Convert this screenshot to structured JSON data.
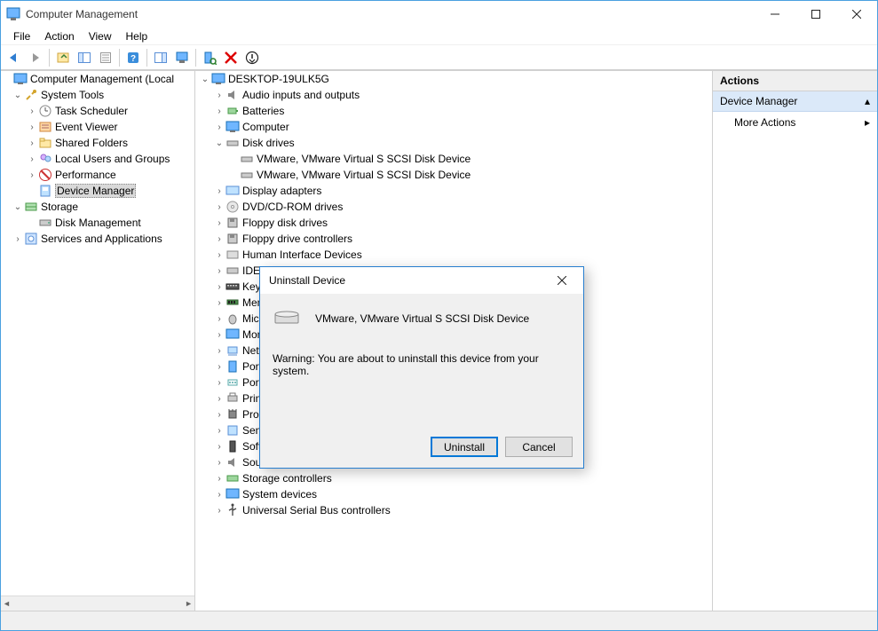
{
  "window": {
    "title": "Computer Management"
  },
  "menu": {
    "file": "File",
    "action": "Action",
    "view": "View",
    "help": "Help"
  },
  "left_tree": {
    "root": "Computer Management (Local",
    "system_tools": "System Tools",
    "task_scheduler": "Task Scheduler",
    "event_viewer": "Event Viewer",
    "shared_folders": "Shared Folders",
    "local_users": "Local Users and Groups",
    "performance": "Performance",
    "device_manager": "Device Manager",
    "storage": "Storage",
    "disk_management": "Disk Management",
    "services_apps": "Services and Applications"
  },
  "center_tree": {
    "root": "DESKTOP-19ULK5G",
    "audio": "Audio inputs and outputs",
    "batteries": "Batteries",
    "computer": "Computer",
    "disk_drives": "Disk drives",
    "disk_item": "VMware, VMware Virtual S SCSI Disk Device",
    "display": "Display adapters",
    "dvd": "DVD/CD-ROM drives",
    "floppy_drives": "Floppy disk drives",
    "floppy_ctrl": "Floppy drive controllers",
    "hid": "Human Interface Devices",
    "ide": "IDE AT",
    "keyboards": "Keybo",
    "memory": "Memo",
    "mice": "Mice a",
    "monitors": "Monit",
    "network": "Netwo",
    "portable": "Portab",
    "ports": "Ports (",
    "print": "Print q",
    "processors": "Proces",
    "sensors": "Senso",
    "software": "Softwa",
    "sound": "Sound, video and game controllers",
    "storage_ctrl": "Storage controllers",
    "system_dev": "System devices",
    "usb": "Universal Serial Bus controllers"
  },
  "actions": {
    "header": "Actions",
    "section": "Device Manager",
    "more": "More Actions"
  },
  "dialog": {
    "title": "Uninstall Device",
    "device": "VMware, VMware Virtual S SCSI Disk Device",
    "warning": "Warning: You are about to uninstall this device from your system.",
    "uninstall": "Uninstall",
    "cancel": "Cancel"
  }
}
